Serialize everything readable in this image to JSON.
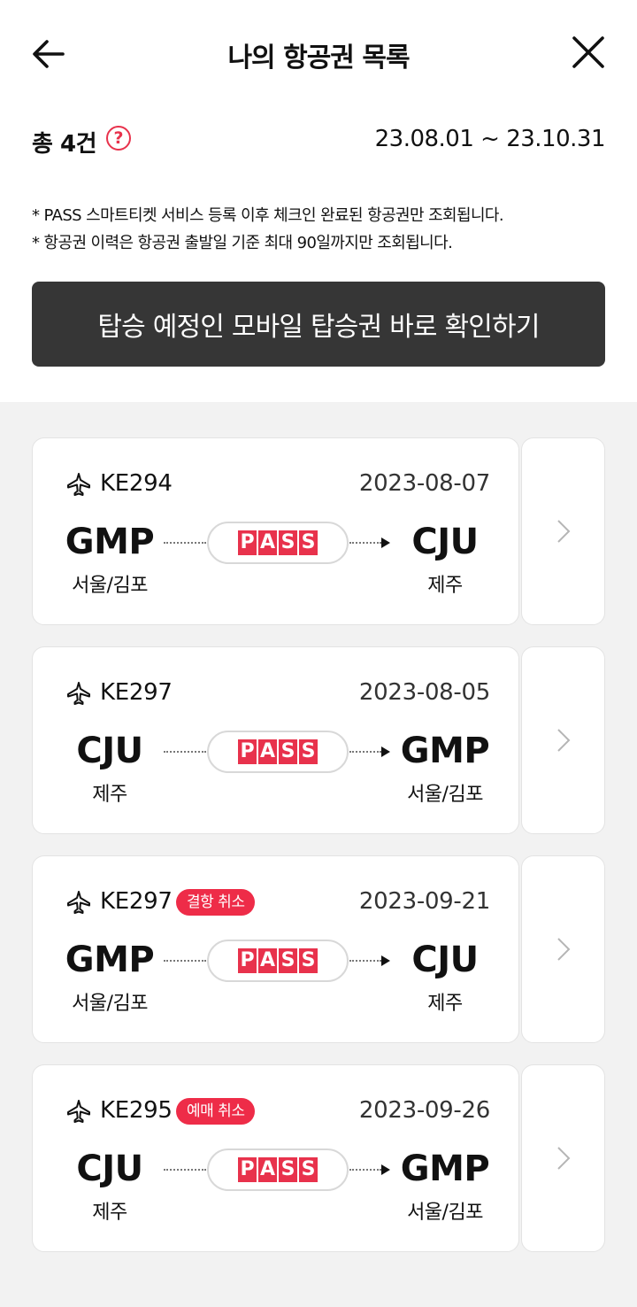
{
  "header": {
    "title": "나의 항공권 목록"
  },
  "summary": {
    "count": "총 4건",
    "help": "?",
    "range": "23.08.01 ~ 23.10.31"
  },
  "notes": [
    "* PASS 스마트티켓 서비스 등록 이후 체크인 완료된 항공권만 조회됩니다.",
    "* 항공권 이력은 항공권 출발일 기준 최대 90일까지만 조회됩니다."
  ],
  "cta": {
    "label": "탑승 예정인 모바일 탑승권 바로 확인하기"
  },
  "pass_letters": [
    "P",
    "A",
    "S",
    "S"
  ],
  "tickets": [
    {
      "flight": "KE294",
      "badge": "",
      "date": "2023-08-07",
      "dep_code": "GMP",
      "dep_city": "서울/김포",
      "arr_code": "CJU",
      "arr_city": "제주"
    },
    {
      "flight": "KE297",
      "badge": "",
      "date": "2023-08-05",
      "dep_code": "CJU",
      "dep_city": "제주",
      "arr_code": "GMP",
      "arr_city": "서울/김포"
    },
    {
      "flight": "KE297",
      "badge": "결항 취소",
      "date": "2023-09-21",
      "dep_code": "GMP",
      "dep_city": "서울/김포",
      "arr_code": "CJU",
      "arr_city": "제주"
    },
    {
      "flight": "KE295",
      "badge": "예매 취소",
      "date": "2023-09-26",
      "dep_code": "CJU",
      "dep_city": "제주",
      "arr_code": "GMP",
      "arr_city": "서울/김포"
    }
  ],
  "colors": {
    "accent": "#e8324c",
    "badge": "#ee2c48",
    "cta_bg": "#363636",
    "list_bg": "#f2f2f2"
  },
  "icons": {
    "back": "arrow-left-icon",
    "close": "close-icon",
    "help": "question-circle-icon",
    "plane": "airplane-icon",
    "chevron": "chevron-right-icon"
  }
}
